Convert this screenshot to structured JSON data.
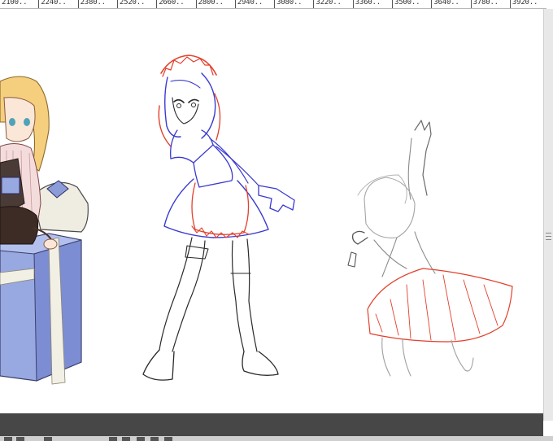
{
  "ruler": {
    "labels": [
      "210",
      "224",
      "238",
      "252",
      "266",
      "280",
      "294",
      "308",
      "322",
      "336",
      "350",
      "364",
      "378",
      "392"
    ],
    "suffix": "0"
  },
  "canvas": {
    "figures": [
      {
        "name": "seated-girl-colored",
        "colors": {
          "hair": "#f5cf7d",
          "box": "#98a8e0",
          "box_dark": "#6f80c5",
          "ribbon": "#f2f0e4",
          "vest": "#4a3b36"
        }
      },
      {
        "name": "maid-girl-lineart",
        "colors": {
          "blue_line": "#3a3ad0",
          "red_line": "#e2402c",
          "black_line": "#2a2a2a"
        }
      },
      {
        "name": "jumping-girl-sketch",
        "colors": {
          "gray_line": "#9a9a9a",
          "red_line": "#e2402c"
        }
      }
    ]
  },
  "colors": {
    "bottom_bar": "#474747",
    "scrollbar": "#e8e8e8"
  }
}
